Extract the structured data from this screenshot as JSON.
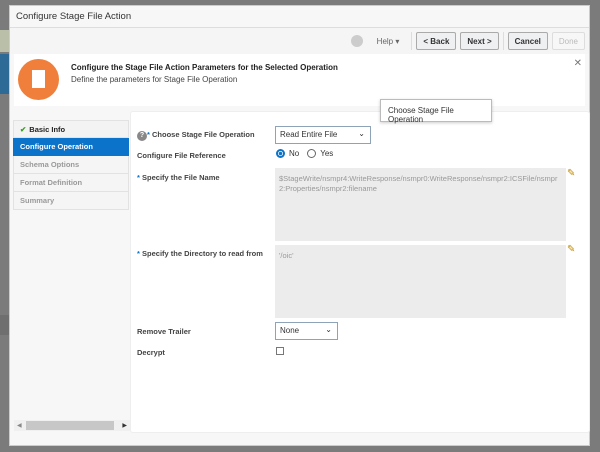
{
  "dialog": {
    "title": "Configure Stage File Action"
  },
  "toolbar": {
    "help": "Help ▾",
    "back": "< Back",
    "next": "Next >",
    "cancel": "Cancel",
    "done": "Done"
  },
  "header": {
    "title": "Configure the Stage File Action Parameters for the Selected Operation",
    "subtitle": "Define the parameters for Stage File Operation",
    "close": "✕"
  },
  "tooltip": "Choose Stage File Operation",
  "nav": {
    "items": [
      {
        "label": "Basic Info",
        "state": "completed"
      },
      {
        "label": "Configure Operation",
        "state": "active"
      },
      {
        "label": "Schema Options",
        "state": "disabled"
      },
      {
        "label": "Format Definition",
        "state": "disabled"
      },
      {
        "label": "Summary",
        "state": "disabled"
      }
    ]
  },
  "form": {
    "operation": {
      "label": "Choose Stage File Operation",
      "value": "Read Entire File",
      "help": "?"
    },
    "file_reference": {
      "label": "Configure File Reference",
      "options": [
        "No",
        "Yes"
      ],
      "selected": "No"
    },
    "file_name": {
      "label": "Specify the File Name",
      "value": "$StageWrite/nsmpr4:WriteResponse/nsmpr0:WriteResponse/nsmpr2:ICSFile/nsmpr2:Properties/nsmpr2:filename"
    },
    "directory": {
      "label": "Specify the Directory to read from",
      "value": "'/oic'"
    },
    "remove_trailer": {
      "label": "Remove Trailer",
      "value": "None"
    },
    "decrypt": {
      "label": "Decrypt",
      "checked": false
    }
  },
  "colors": {
    "accent": "#0b73c9",
    "logo": "#ef7f3a"
  }
}
